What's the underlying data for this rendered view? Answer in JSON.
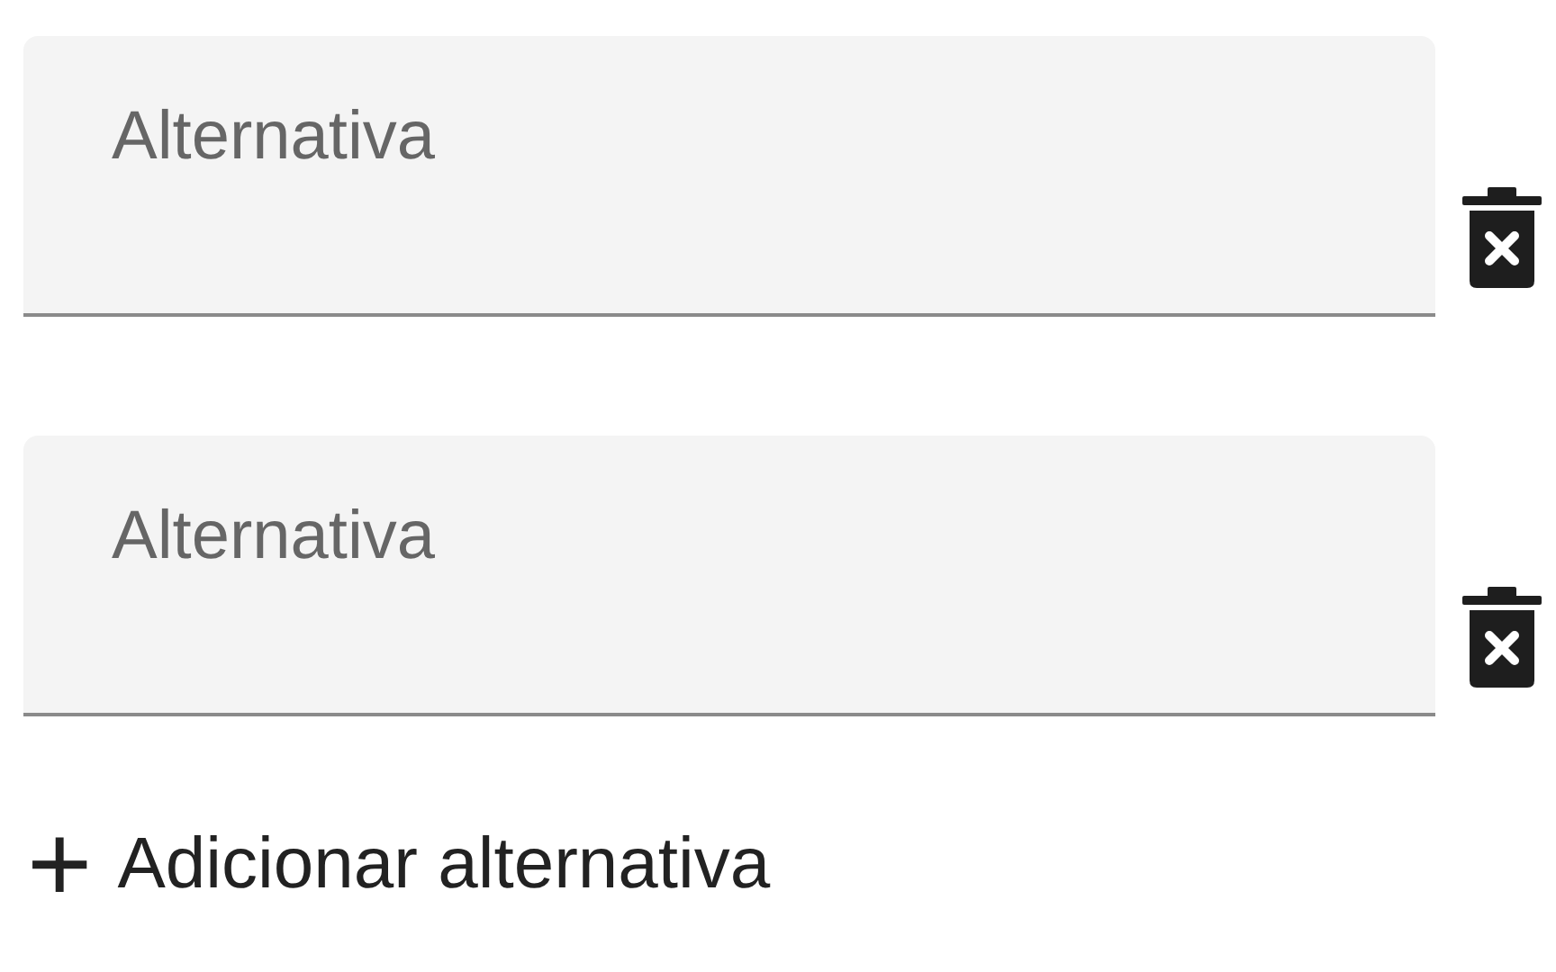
{
  "alternatives": [
    {
      "placeholder": "Alternativa"
    },
    {
      "placeholder": "Alternativa"
    }
  ],
  "add_button": {
    "icon": "+",
    "label": "Adicionar alternativa"
  }
}
